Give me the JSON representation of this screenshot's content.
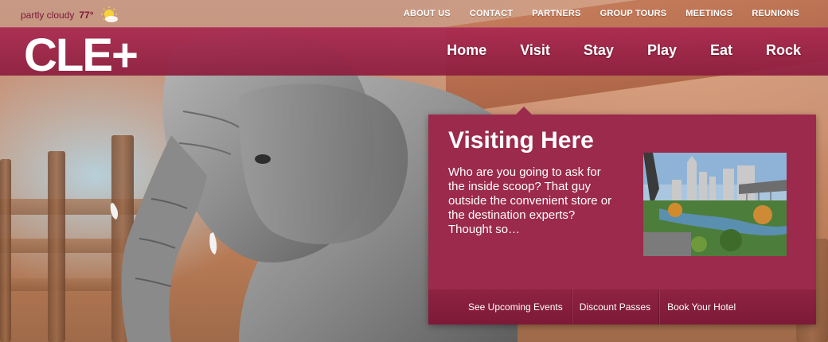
{
  "weather": {
    "condition": "partly cloudy",
    "temperature": "77°",
    "icon": "partly-cloudy-icon"
  },
  "utility_nav": [
    "ABOUT US",
    "CONTACT",
    "PARTNERS",
    "GROUP TOURS",
    "MEETINGS",
    "REUNIONS"
  ],
  "logo": {
    "text": "CLE+"
  },
  "main_nav": [
    "Home",
    "Visit",
    "Stay",
    "Play",
    "Eat",
    "Rock"
  ],
  "panel": {
    "title": "Visiting Here",
    "blurb": "Who are you going to ask for the inside scoop? That guy outside the convenient store or the destination experts? Thought so…",
    "links": [
      "See Upcoming Events",
      "Discount Passes",
      "Book Your Hotel"
    ]
  },
  "colors": {
    "brand": "#9b2a4c",
    "brand_dark": "#7d1a38",
    "weather_text": "#7c1936"
  }
}
